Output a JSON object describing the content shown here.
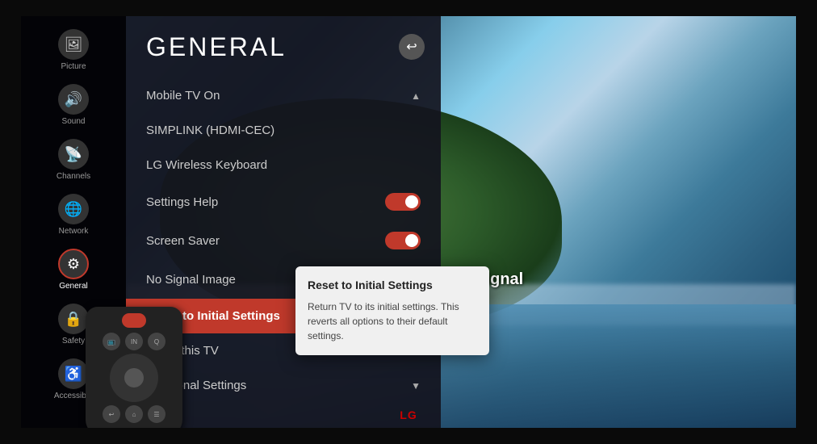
{
  "screen": {
    "title": "GENERAL",
    "back_button_label": "↩"
  },
  "sidebar": {
    "items": [
      {
        "id": "picture",
        "label": "Picture",
        "icon": "🖼",
        "active": false
      },
      {
        "id": "sound",
        "label": "Sound",
        "icon": "🔊",
        "active": false
      },
      {
        "id": "channels",
        "label": "Channels",
        "icon": "📡",
        "active": false
      },
      {
        "id": "network",
        "label": "Network",
        "icon": "🌐",
        "active": false
      },
      {
        "id": "general",
        "label": "General",
        "icon": "⚙",
        "active": true
      },
      {
        "id": "safety",
        "label": "Safety",
        "icon": "🔒",
        "active": false
      },
      {
        "id": "accessibility",
        "label": "Accessib...",
        "icon": "♿",
        "active": false
      }
    ]
  },
  "menu": {
    "items": [
      {
        "id": "mobile-tv",
        "label": "Mobile TV On",
        "has_toggle": false,
        "chevron": "up",
        "active": false
      },
      {
        "id": "simplink",
        "label": "SIMPLINK (HDMI-CEC)",
        "has_toggle": false,
        "chevron": null,
        "active": false
      },
      {
        "id": "lg-keyboard",
        "label": "LG Wireless Keyboard",
        "has_toggle": false,
        "chevron": null,
        "active": false
      },
      {
        "id": "settings-help",
        "label": "Settings Help",
        "has_toggle": true,
        "toggle_on": true,
        "chevron": null,
        "active": false
      },
      {
        "id": "screen-saver",
        "label": "Screen Saver",
        "has_toggle": true,
        "toggle_on": true,
        "chevron": null,
        "active": false
      },
      {
        "id": "no-signal-image",
        "label": "No Signal Image",
        "has_toggle": true,
        "toggle_on": true,
        "chevron": null,
        "active": false
      },
      {
        "id": "reset",
        "label": "Reset to Initial Settings",
        "has_toggle": false,
        "chevron": null,
        "active": true
      },
      {
        "id": "about-tv",
        "label": "About this TV",
        "has_toggle": false,
        "chevron": null,
        "active": false
      },
      {
        "id": "additional",
        "label": "Additional Settings",
        "has_toggle": false,
        "chevron": "down",
        "active": false
      }
    ]
  },
  "tooltip": {
    "title": "Reset to Initial Settings",
    "body": "Return TV to its initial settings. This reverts all options to their default settings."
  },
  "no_signal": {
    "text": "No Signal"
  },
  "lg_logo": "LG"
}
